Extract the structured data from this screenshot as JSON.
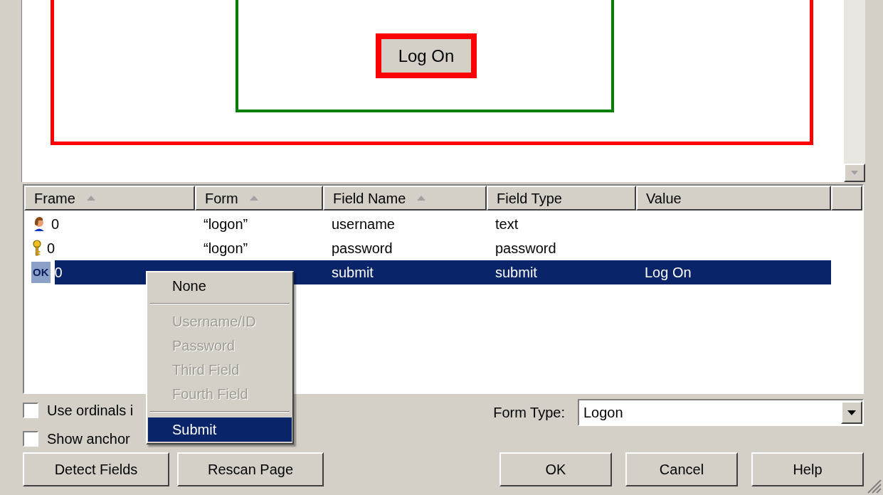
{
  "preview": {
    "button": "Log On"
  },
  "table": {
    "columns": [
      {
        "label": "Frame",
        "sorted": true
      },
      {
        "label": "Form",
        "sorted": true
      },
      {
        "label": "Field Name",
        "sorted": true
      },
      {
        "label": "Field Type",
        "sorted": false
      },
      {
        "label": "Value",
        "sorted": false
      }
    ],
    "rows": [
      {
        "kind": "user",
        "frame": "0",
        "form": "“logon”",
        "field_name": "username",
        "field_type": "text",
        "value": "",
        "selected": false
      },
      {
        "kind": "key",
        "frame": "0",
        "form": "“logon”",
        "field_name": "password",
        "field_type": "password",
        "value": "",
        "selected": false
      },
      {
        "kind": "ok",
        "badge": "OK",
        "frame": "0",
        "field_name": "submit",
        "field_type": "submit",
        "value": "Log On",
        "selected": true
      }
    ]
  },
  "context_menu": [
    {
      "kind": "item",
      "label": "None",
      "disabled": false,
      "selected": false
    },
    {
      "kind": "separator"
    },
    {
      "kind": "item",
      "label": "Username/ID",
      "disabled": true,
      "selected": false
    },
    {
      "kind": "item",
      "label": "Password",
      "disabled": true,
      "selected": false
    },
    {
      "kind": "item",
      "label": "Third Field",
      "disabled": true,
      "selected": false
    },
    {
      "kind": "item",
      "label": "Fourth Field",
      "disabled": true,
      "selected": false
    },
    {
      "kind": "separator"
    },
    {
      "kind": "item",
      "label": "Submit",
      "disabled": false,
      "selected": true
    }
  ],
  "checkboxes": [
    {
      "label": "Use ordinals i",
      "checked": false
    },
    {
      "label": "Show anchor",
      "checked": false
    }
  ],
  "form_type": {
    "label": "Form Type:",
    "value": "Logon"
  },
  "left_buttons": [
    "Detect Fields",
    "Rescan Page"
  ],
  "right_buttons": [
    "OK",
    "Cancel",
    "Help"
  ]
}
